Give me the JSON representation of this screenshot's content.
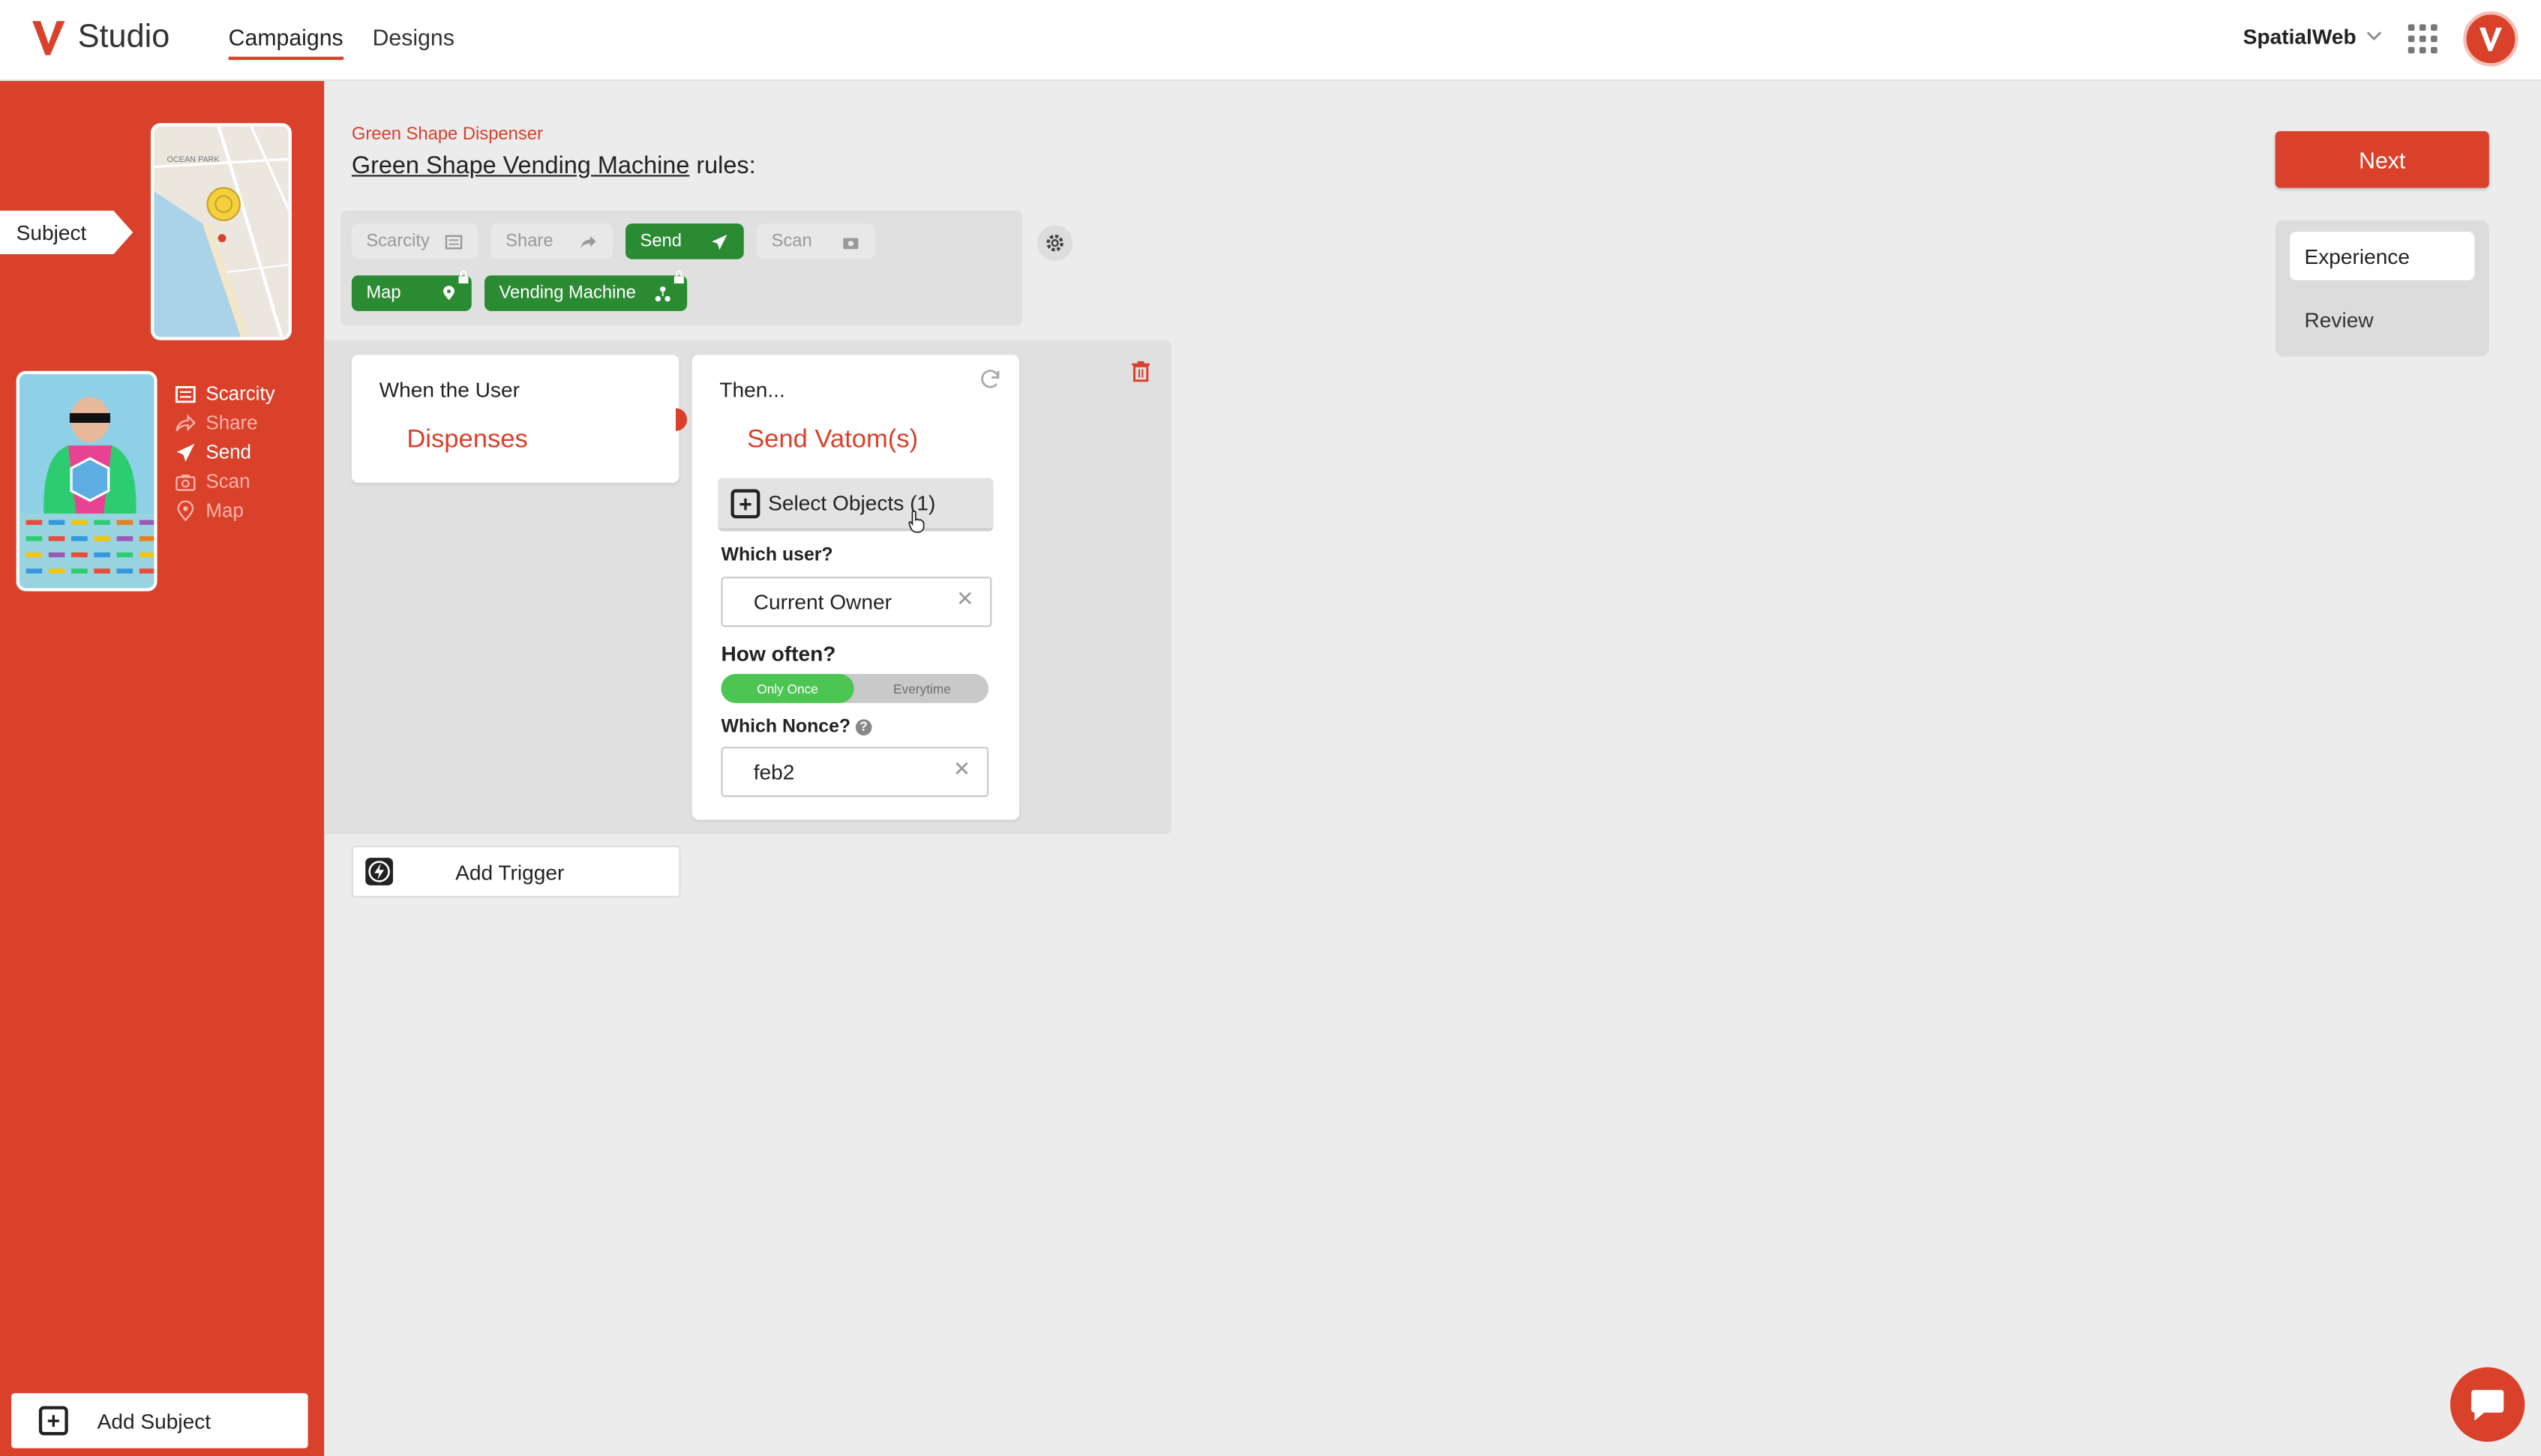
{
  "header": {
    "brand": "Studio",
    "nav": [
      {
        "label": "Campaigns",
        "active": true
      },
      {
        "label": "Designs",
        "active": false
      }
    ],
    "org": "SpatialWeb"
  },
  "sidebar": {
    "subject_tag": "Subject",
    "actions": [
      {
        "label": "Scarcity",
        "icon": "scarcity-icon",
        "enabled": true
      },
      {
        "label": "Share",
        "icon": "share-icon",
        "enabled": false
      },
      {
        "label": "Send",
        "icon": "send-icon",
        "enabled": true
      },
      {
        "label": "Scan",
        "icon": "camera-icon",
        "enabled": false
      },
      {
        "label": "Map",
        "icon": "map-pin-icon",
        "enabled": false
      }
    ],
    "add_subject": "Add Subject"
  },
  "main": {
    "breadcrumb": "Green Shape Dispenser",
    "title_link": "Green Shape Vending Machine",
    "title_suffix": " rules:",
    "chips": [
      {
        "label": "Scarcity",
        "on": false
      },
      {
        "label": "Share",
        "on": false
      },
      {
        "label": "Send",
        "on": true
      },
      {
        "label": "Scan",
        "on": false
      },
      {
        "label": "Map",
        "on": true,
        "locked": true
      },
      {
        "label": "Vending Machine",
        "on": true,
        "locked": true
      }
    ],
    "trigger_card": {
      "title": "When the User",
      "action": "Dispenses"
    },
    "action_card": {
      "title": "Then...",
      "action": "Send Vatom(s)",
      "select_objects": "Select Objects (1)",
      "which_user_label": "Which user?",
      "which_user_value": "Current Owner",
      "how_often_label": "How often?",
      "how_often_options": [
        "Only Once",
        "Everytime"
      ],
      "how_often_selected": "Only Once",
      "nonce_label": "Which Nonce?",
      "nonce_value": "feb2"
    },
    "add_trigger": "Add Trigger"
  },
  "right": {
    "next": "Next",
    "steps": [
      "Experience",
      "Review"
    ],
    "current_step": "Experience"
  },
  "colors": {
    "brand_red": "#d9412b",
    "chip_green": "#2a8b33",
    "toggle_green": "#4cc552"
  }
}
